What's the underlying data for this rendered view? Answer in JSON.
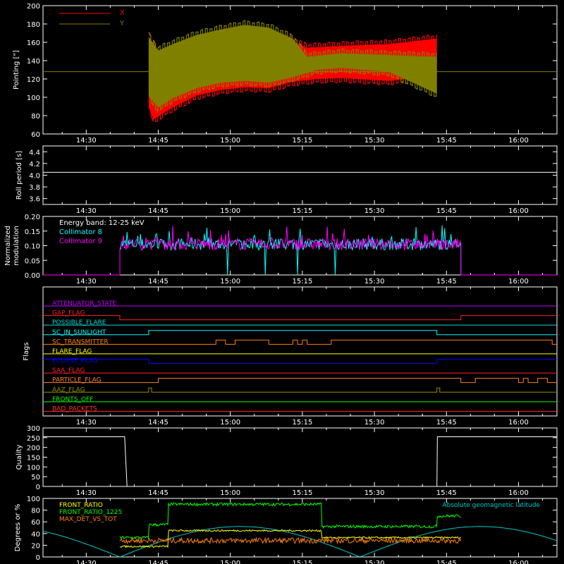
{
  "colors": {
    "background": "#000000",
    "axes": "#ffffff",
    "x_pointing": "#ff0000",
    "y_pointing": "#808000",
    "collimator8": "#00ffff",
    "collimator9": "#ff00ff",
    "front_ratio": "#ffff00",
    "front_ratio_1225": "#00ff00",
    "max_det": "#ff8000",
    "geomag": "#00c8c8"
  },
  "time_axis": {
    "range": [
      "14:21",
      "16:08"
    ],
    "ticks": [
      "14:30",
      "14:45",
      "15:00",
      "15:15",
      "15:30",
      "15:45",
      "16:00"
    ]
  },
  "chart_data": [
    {
      "id": "pointing",
      "type": "line",
      "ylabel": "Pointing [\"]",
      "ylim": [
        60,
        200
      ],
      "yticks": [
        60,
        80,
        100,
        120,
        140,
        160,
        180,
        200
      ],
      "legend": "top-left",
      "series": [
        {
          "name": "X",
          "color": "#ff0000",
          "data_range": [
            "14:43",
            "15:43"
          ],
          "upper_envelope": [
            [
              0,
              170
            ],
            [
              2,
              150
            ],
            [
              5,
              155
            ],
            [
              10,
              162
            ],
            [
              15,
              168
            ],
            [
              20,
              173
            ],
            [
              25,
              172
            ],
            [
              30,
              165
            ],
            [
              33,
              158
            ],
            [
              40,
              160
            ],
            [
              50,
              162
            ],
            [
              60,
              168
            ]
          ],
          "lower_envelope": [
            [
              0,
              85
            ],
            [
              1,
              72
            ],
            [
              5,
              85
            ],
            [
              10,
              98
            ],
            [
              15,
              104
            ],
            [
              20,
              107
            ],
            [
              25,
              106
            ],
            [
              30,
              113
            ],
            [
              35,
              116
            ],
            [
              40,
              117
            ],
            [
              50,
              114
            ],
            [
              60,
              120
            ]
          ]
        },
        {
          "name": "Y",
          "color": "#808000",
          "data_range": [
            "14:43",
            "15:43"
          ],
          "upper_envelope": [
            [
              0,
              170
            ],
            [
              2,
              155
            ],
            [
              5,
              162
            ],
            [
              10,
              172
            ],
            [
              15,
              178
            ],
            [
              20,
              183
            ],
            [
              25,
              180
            ],
            [
              30,
              168
            ],
            [
              33,
              148
            ],
            [
              40,
              152
            ],
            [
              50,
              150
            ],
            [
              60,
              148
            ]
          ],
          "lower_envelope": [
            [
              0,
              97
            ],
            [
              2,
              85
            ],
            [
              5,
              95
            ],
            [
              10,
              106
            ],
            [
              15,
              112
            ],
            [
              20,
              114
            ],
            [
              25,
              112
            ],
            [
              30,
              118
            ],
            [
              35,
              126
            ],
            [
              40,
              128
            ],
            [
              50,
              124
            ],
            [
              60,
              100
            ]
          ]
        }
      ],
      "reference_line": 128
    },
    {
      "id": "roll_period",
      "type": "line",
      "ylabel": "Roll period [s]",
      "ylim": [
        3.5,
        4.5
      ],
      "yticks": [
        3.6,
        3.8,
        4.0,
        4.2,
        4.4
      ],
      "series": [
        {
          "name": "",
          "color": "#ffffff",
          "values": [
            4.05
          ]
        }
      ]
    },
    {
      "id": "modulation",
      "type": "line",
      "ylabel": "Normalized modulation",
      "ylim": [
        0,
        0.2
      ],
      "yticks": [
        "0.00",
        "0.05",
        "0.10",
        "0.15",
        "0.20"
      ],
      "annotation": "Energy band: 12-25 keV",
      "data_range": [
        "14:37",
        "15:48"
      ],
      "series": [
        {
          "name": "Collimator 8",
          "color": "#00ffff",
          "base": 0.1
        },
        {
          "name": "Collimator 9",
          "color": "#ff00ff",
          "base": 0.1
        }
      ]
    },
    {
      "id": "flags",
      "type": "line",
      "ylabel": "Flags",
      "series": [
        {
          "name": "ATTENUATOR_STATE",
          "color": "#c000ff",
          "states": [
            [
              0,
              0
            ]
          ]
        },
        {
          "name": "SAA_FLAG_GAP",
          "label": "GAP_FLAG",
          "color": "#ff2020",
          "states": [
            [
              0,
              0
            ],
            [
              16,
              -1
            ],
            [
              87,
              0
            ]
          ]
        },
        {
          "name": "POSSIBLE_FLARE",
          "color": "#00d8d8",
          "states": [
            [
              0,
              0
            ]
          ]
        },
        {
          "name": "SC_IN_SUNLIGHT",
          "color": "#00ffff",
          "states": [
            [
              0,
              0
            ],
            [
              22,
              1
            ],
            [
              82,
              0
            ]
          ]
        },
        {
          "name": "SC_TRANSMITTER",
          "color": "#ff8000",
          "states": [
            [
              0,
              0
            ],
            [
              36,
              1
            ],
            [
              38,
              0
            ],
            [
              40,
              1
            ],
            [
              47,
              0
            ],
            [
              52,
              1
            ],
            [
              53,
              0
            ],
            [
              54,
              1
            ],
            [
              55,
              0
            ],
            [
              60,
              1
            ],
            [
              106,
              0
            ]
          ]
        },
        {
          "name": "FLARE_FLAG",
          "color": "#ffff00",
          "states": [
            [
              0,
              0
            ]
          ]
        },
        {
          "name": "ECLIPSE_FLAG",
          "color": "#0000ff",
          "states": [
            [
              0,
              1
            ],
            [
              22,
              0
            ],
            [
              82,
              1
            ]
          ]
        },
        {
          "name": "SAA_FLAG",
          "color": "#ff2020",
          "states": [
            [
              0,
              0
            ]
          ]
        },
        {
          "name": "PARTICLE_FLAG",
          "color": "#ff8020",
          "states": [
            [
              0,
              0
            ],
            [
              24,
              1
            ],
            [
              87,
              0
            ],
            [
              90,
              1
            ],
            [
              99,
              0
            ],
            [
              100,
              1
            ],
            [
              101,
              0
            ],
            [
              103,
              1
            ],
            [
              105,
              0
            ]
          ]
        },
        {
          "name": "AAZ_FLAG",
          "color": "#909000",
          "states": [
            [
              0,
              0
            ],
            [
              22,
              1
            ],
            [
              22.6,
              0
            ],
            [
              82,
              1
            ],
            [
              82.6,
              0
            ]
          ]
        },
        {
          "name": "FRONTS_OFF",
          "color": "#00ff00",
          "states": [
            [
              0,
              0
            ]
          ]
        },
        {
          "name": "BAD_PACKETS",
          "color": "#ff3030",
          "states": [
            [
              0,
              0
            ]
          ]
        }
      ]
    },
    {
      "id": "quality",
      "type": "line",
      "ylabel": "Quality",
      "ylim": [
        0,
        300
      ],
      "yticks": [
        0,
        50,
        100,
        150,
        200,
        250,
        300
      ],
      "series": [
        {
          "name": "",
          "color": "#ffffff",
          "steps": [
            [
              0,
              255
            ],
            [
              17,
              255
            ],
            [
              17.5,
              0
            ],
            [
              82,
              0
            ],
            [
              82.1,
              255
            ],
            [
              107,
              255
            ]
          ]
        }
      ]
    },
    {
      "id": "ratios",
      "type": "line",
      "ylabel": "Degrees or %",
      "ylim": [
        0,
        100
      ],
      "yticks": [
        0,
        20,
        40,
        60,
        80,
        100
      ],
      "legend": "top-left",
      "series": [
        {
          "name": "FRONT_RATIO",
          "color": "#ffff00"
        },
        {
          "name": "FRONT_RATIO_1225",
          "color": "#00ff00"
        },
        {
          "name": "MAX_DET_VS_TOT",
          "color": "#ff8000"
        },
        {
          "name": "Absolute geomagnetic latitude",
          "color": "#00c8c8"
        }
      ]
    }
  ],
  "labels": {
    "pointing_ylabel": "Pointing [\"]",
    "roll_ylabel": "Roll period [s]",
    "mod_ylabel_1": "Normalized",
    "mod_ylabel_2": "modulation",
    "flags_ylabel": "Flags",
    "quality_ylabel": "Quality",
    "ratios_ylabel": "Degrees or %",
    "legend_x": "X",
    "legend_y": "Y",
    "energy_band": "Energy band: 12-25 keV",
    "coll8": "Collimator 8",
    "coll9": "Collimator 9",
    "front_ratio": "FRONT_RATIO",
    "front_ratio_1225": "FRONT_RATIO_1225",
    "max_det": "MAX_DET_VS_TOT",
    "geomag": "Absolute geomagnetic latitude"
  }
}
